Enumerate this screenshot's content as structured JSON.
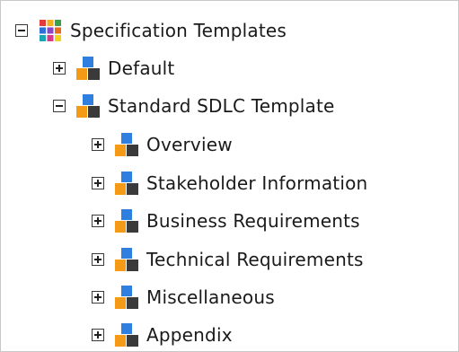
{
  "tree": {
    "root": {
      "label": "Specification Templates",
      "expanded": true,
      "icon": "color-grid-icon"
    },
    "templates": [
      {
        "label": "Default",
        "expanded": false,
        "icon": "template-blocks-icon"
      },
      {
        "label": "Standard SDLC Template",
        "expanded": true,
        "icon": "template-blocks-icon"
      }
    ],
    "sections": [
      {
        "label": "Overview",
        "expanded": false,
        "icon": "section-blocks-icon"
      },
      {
        "label": "Stakeholder Information",
        "expanded": false,
        "icon": "section-blocks-icon"
      },
      {
        "label": "Business Requirements",
        "expanded": false,
        "icon": "section-blocks-icon"
      },
      {
        "label": "Technical Requirements",
        "expanded": false,
        "icon": "section-blocks-icon"
      },
      {
        "label": "Miscellaneous",
        "expanded": false,
        "icon": "section-blocks-icon"
      },
      {
        "label": "Appendix",
        "expanded": false,
        "icon": "section-blocks-icon"
      }
    ]
  },
  "colors": {
    "block_blue": "#2f7fe0",
    "block_orange": "#f59a16",
    "block_dark": "#3a3a3a",
    "text": "#1a1a1a"
  }
}
